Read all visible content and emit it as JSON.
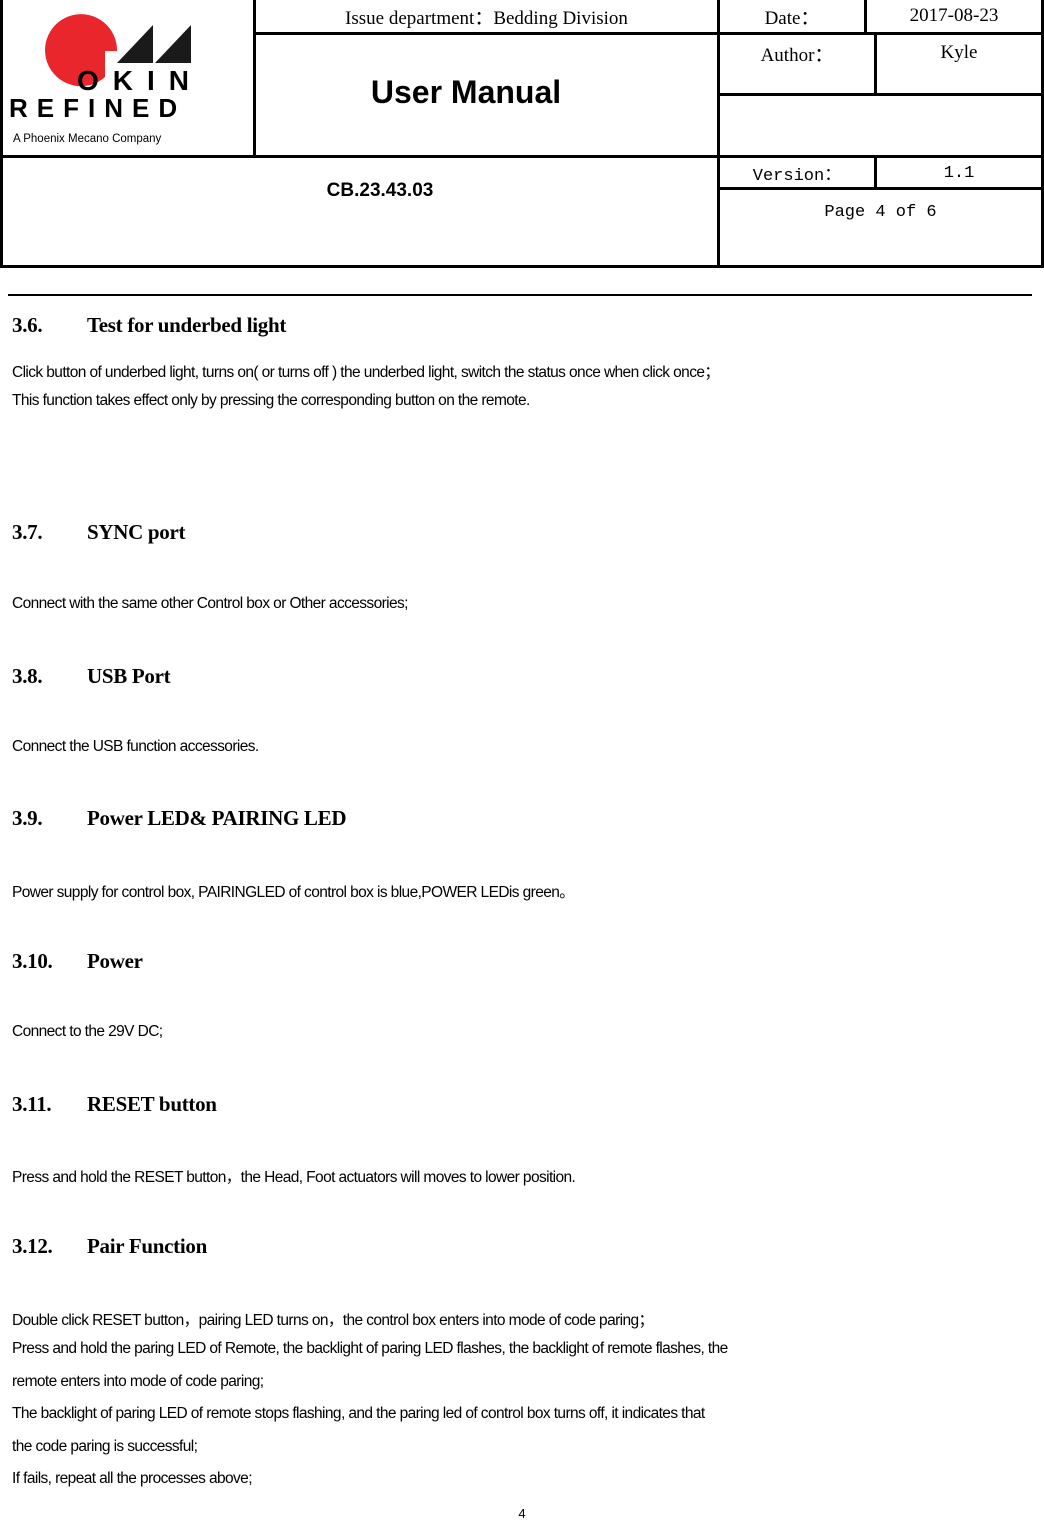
{
  "header": {
    "logo": {
      "brand_top": "OKIN",
      "brand_bottom": "REFINED",
      "tagline": "A Phoenix Mecano Company",
      "colors": {
        "red": "#e8262c",
        "black": "#1a1a1a"
      }
    },
    "issue_department": "Issue department：Bedding Division",
    "date_label": "Date：",
    "date_value": "2017-08-23",
    "title": "User Manual",
    "author_label": "Author：",
    "author_value": "Kyle",
    "doc_number": "CB.23.43.03",
    "version_label": "Version：",
    "version_value": "1.1",
    "page_info": "Page 4 of 6"
  },
  "sections": [
    {
      "number": "3.6.",
      "title": "Test for underbed light",
      "paragraphs": [
        "Click button of underbed light, turns on( or turns off ) the underbed light, switch the status once when click once；",
        "This function takes effect only by pressing the corresponding button on the remote."
      ]
    },
    {
      "number": "3.7.",
      "title": "SYNC port",
      "paragraphs": [
        "Connect with the same other Control box or Other accessories;"
      ]
    },
    {
      "number": "3.8.",
      "title": "USB Port",
      "paragraphs": [
        "Connect the USB function accessories."
      ]
    },
    {
      "number": "3.9.",
      "title": "Power LED& PAIRING LED",
      "paragraphs": [
        "Power supply for control box, PAIRINGLED of control box is blue,POWER LEDis green。"
      ]
    },
    {
      "number": "3.10.",
      "title": "Power",
      "paragraphs": [
        "Connect to the 29V DC;"
      ]
    },
    {
      "number": "3.11.",
      "title": "RESET button",
      "paragraphs": [
        "Press and hold the RESET button，the Head, Foot actuators will moves to lower position."
      ]
    },
    {
      "number": "3.12.",
      "title": "Pair Function",
      "paragraphs": [
        "Double click RESET button，pairing LED turns on，the control box enters into mode of code paring；",
        "Press and hold the paring LED of Remote, the backlight of paring LED flashes, the backlight of remote flashes, the",
        "remote enters into mode of code paring;",
        "The backlight of paring LED of remote stops flashing, and the paring led of control box turns off, it indicates that",
        "the code paring is successful;",
        "If fails, repeat all the processes above;"
      ]
    }
  ],
  "footer": {
    "page_number": "4"
  }
}
